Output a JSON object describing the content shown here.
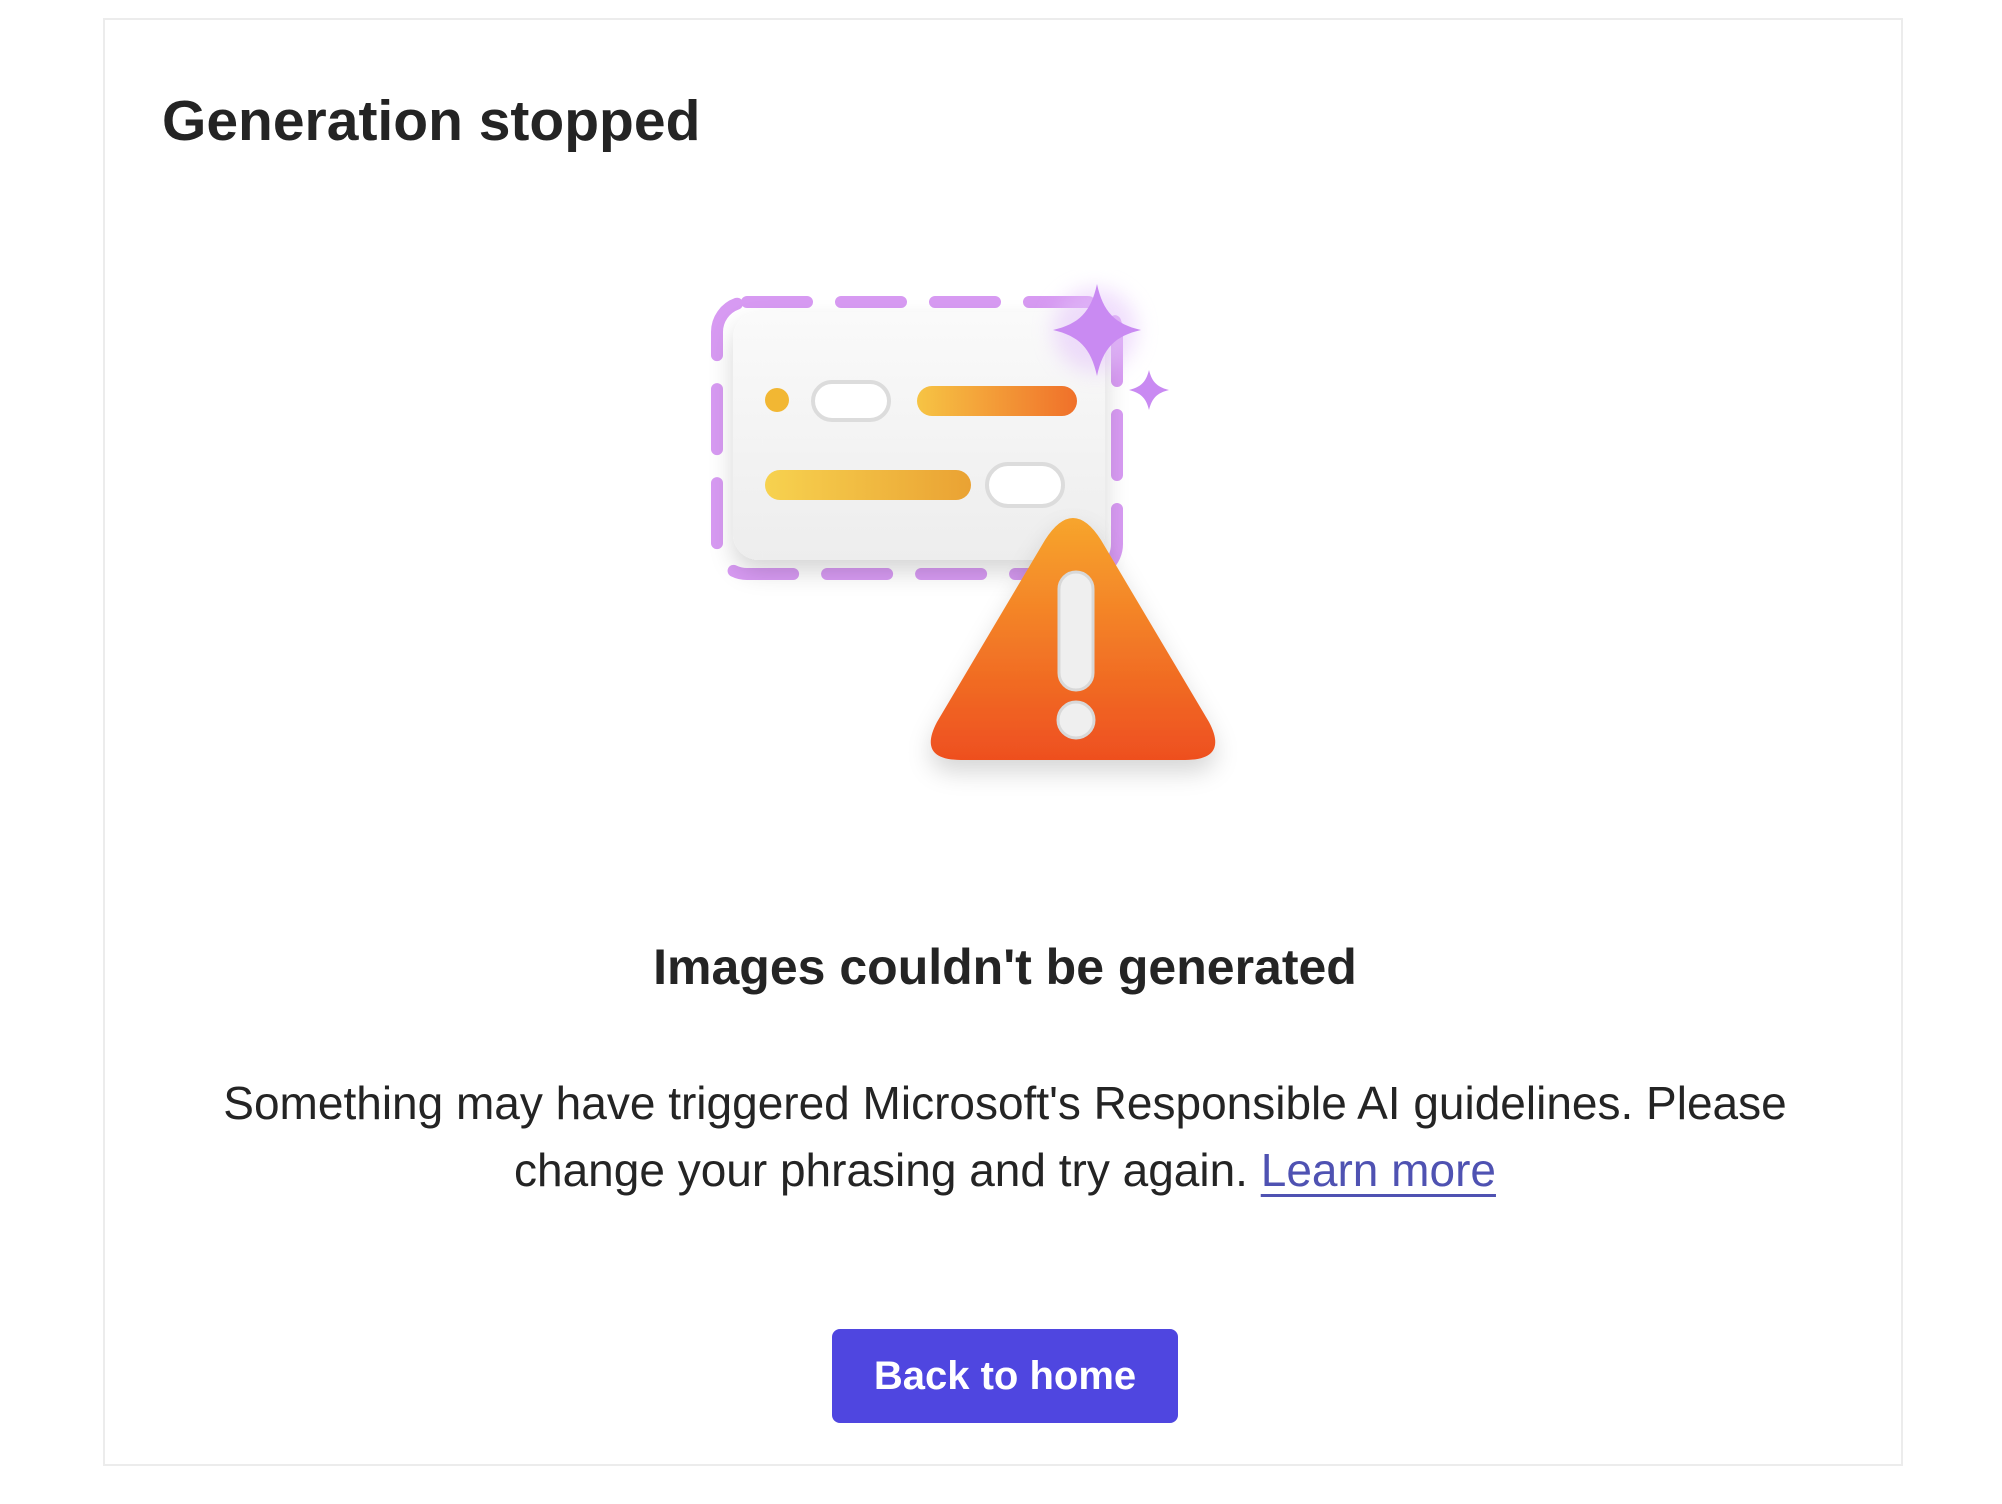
{
  "dialog": {
    "title": "Generation stopped",
    "heading": "Images couldn't be generated",
    "message": "Something may have triggered Microsoft's Responsible AI guidelines. Please change your phrasing and try again.",
    "learn_more_label": "Learn more",
    "back_button_label": "Back to home"
  },
  "illustration": {
    "icon": "warning-illustration-icon",
    "colors": {
      "accent": "#4f46e0",
      "link": "#4f52b2",
      "warning_orange": "#f06a1f",
      "sparkle_purple": "#c98af2"
    }
  }
}
